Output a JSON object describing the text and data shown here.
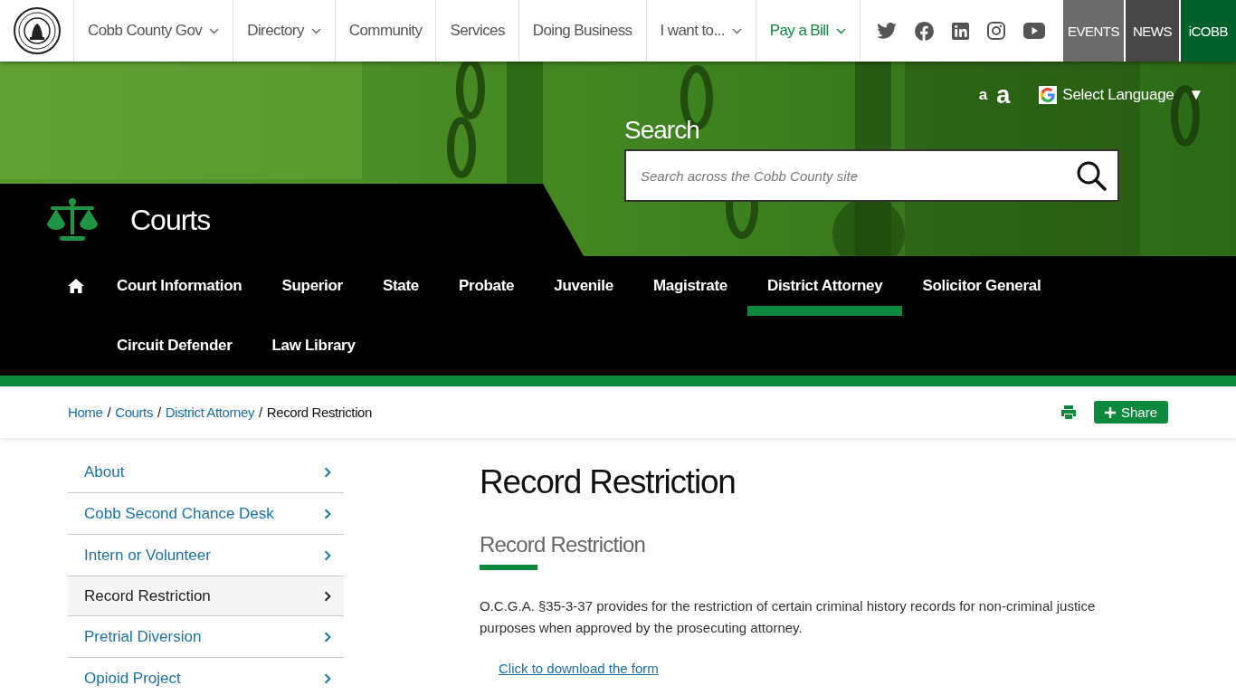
{
  "top_nav": {
    "items": [
      {
        "label": "Cobb County Gov",
        "dropdown": true,
        "highlighted": false
      },
      {
        "label": "Directory",
        "dropdown": true,
        "highlighted": false
      },
      {
        "label": "Community",
        "dropdown": false,
        "highlighted": false
      },
      {
        "label": "Services",
        "dropdown": false,
        "highlighted": false
      },
      {
        "label": "Doing Business",
        "dropdown": false,
        "highlighted": false
      },
      {
        "label": "I want to...",
        "dropdown": true,
        "highlighted": false
      },
      {
        "label": "Pay a Bill",
        "dropdown": true,
        "highlighted": true
      }
    ],
    "buttons": [
      {
        "label": "EVENTS",
        "color": "#6b6b6b"
      },
      {
        "label": "NEWS",
        "color": "#474747"
      },
      {
        "label": "iCOBB",
        "color": "#00602b"
      }
    ]
  },
  "hero": {
    "font_small": "a",
    "font_large": "a",
    "language": "Select Language",
    "language_caret": "▼",
    "search_label": "Search",
    "search_placeholder": "Search across the Cobb County site"
  },
  "department": {
    "title": "Courts"
  },
  "section_nav": {
    "items": [
      {
        "label": "Court Information",
        "selected": false
      },
      {
        "label": "Superior",
        "selected": false
      },
      {
        "label": "State",
        "selected": false
      },
      {
        "label": "Probate",
        "selected": false
      },
      {
        "label": "Juvenile",
        "selected": false
      },
      {
        "label": "Magistrate",
        "selected": false
      },
      {
        "label": "District Attorney",
        "selected": true
      },
      {
        "label": "Solicitor General",
        "selected": false
      },
      {
        "label": "Circuit Defender",
        "selected": false
      },
      {
        "label": "Law Library",
        "selected": false
      }
    ]
  },
  "breadcrumbs": [
    {
      "label": "Home",
      "link": true
    },
    {
      "separator": "/",
      "label": "Courts",
      "link": true
    },
    {
      "separator": "/",
      "label": "District Attorney",
      "link": true
    },
    {
      "separator": "/",
      "label": "Record Restriction",
      "link": false
    }
  ],
  "share_label": "Share",
  "sidebar": {
    "items": [
      {
        "label": "About",
        "selected": false
      },
      {
        "label": "Cobb Second Chance Desk",
        "selected": false
      },
      {
        "label": "Intern or Volunteer",
        "selected": false
      },
      {
        "label": "Record Restriction",
        "selected": true
      },
      {
        "label": "Pretrial Diversion",
        "selected": false
      },
      {
        "label": "Opioid Project",
        "selected": false
      }
    ]
  },
  "article": {
    "title": "Record Restriction",
    "subtitle": "Record Restriction",
    "paragraph": "O.C.G.A. §35-3-37 provides for the restriction of certain criminal history records for non-criminal justice purposes when approved by the prosecuting attorney.",
    "link": "Click to download the form"
  }
}
